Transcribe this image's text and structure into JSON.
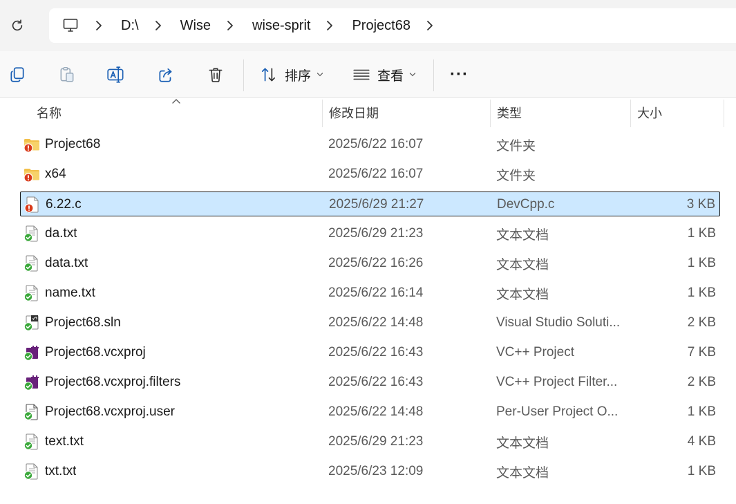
{
  "address": {
    "segments": [
      "D:\\",
      "Wise",
      "wise-sprit",
      "Project68"
    ]
  },
  "toolbar": {
    "sort_label": "排序",
    "view_label": "查看",
    "more_label": "···"
  },
  "columns": {
    "name": "名称",
    "modified": "修改日期",
    "type": "类型",
    "size": "大小"
  },
  "files": [
    {
      "name": "Project68",
      "modified": "2025/6/22 16:07",
      "type": "文件夹",
      "size": "",
      "icon": "folder-warning-icon"
    },
    {
      "name": "x64",
      "modified": "2025/6/22 16:07",
      "type": "文件夹",
      "size": "",
      "icon": "folder-warning-icon"
    },
    {
      "name": "6.22.c",
      "modified": "2025/6/29 21:27",
      "type": "DevCpp.c",
      "size": "3 KB",
      "icon": "file-warning-icon"
    },
    {
      "name": "da.txt",
      "modified": "2025/6/29 21:23",
      "type": "文本文档",
      "size": "1 KB",
      "icon": "text-file-synced-icon"
    },
    {
      "name": "data.txt",
      "modified": "2025/6/22 16:26",
      "type": "文本文档",
      "size": "1 KB",
      "icon": "text-file-synced-icon"
    },
    {
      "name": "name.txt",
      "modified": "2025/6/22 16:14",
      "type": "文本文档",
      "size": "1 KB",
      "icon": "text-file-synced-icon"
    },
    {
      "name": "Project68.sln",
      "modified": "2025/6/22 14:48",
      "type": "Visual Studio Soluti...",
      "size": "2 KB",
      "icon": "sln-file-synced-icon"
    },
    {
      "name": "Project68.vcxproj",
      "modified": "2025/6/22 16:43",
      "type": "VC++ Project",
      "size": "7 KB",
      "icon": "vcxproj-file-synced-icon"
    },
    {
      "name": "Project68.vcxproj.filters",
      "modified": "2025/6/22 16:43",
      "type": "VC++ Project Filter...",
      "size": "2 KB",
      "icon": "vcxproj-file-synced-icon"
    },
    {
      "name": "Project68.vcxproj.user",
      "modified": "2025/6/22 14:48",
      "type": "Per-User Project O...",
      "size": "1 KB",
      "icon": "user-file-synced-icon"
    },
    {
      "name": "text.txt",
      "modified": "2025/6/29 21:23",
      "type": "文本文档",
      "size": "4 KB",
      "icon": "text-file-synced-icon"
    },
    {
      "name": "txt.txt",
      "modified": "2025/6/23 12:09",
      "type": "文本文档",
      "size": "1 KB",
      "icon": "text-file-synced-icon"
    }
  ],
  "selected_index": 2,
  "colors": {
    "selection_bg": "#cce8ff",
    "folder": "#f2c04b",
    "warning": "#d93a1a",
    "synced": "#3aa83a"
  }
}
